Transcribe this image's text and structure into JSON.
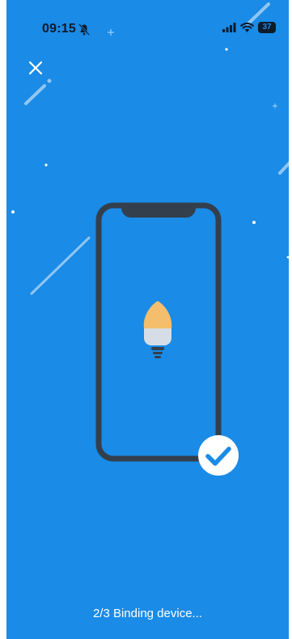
{
  "status_bar": {
    "time": "09:15",
    "battery_level": "37",
    "icons": [
      "bell-slash-icon",
      "cellular-signal-icon",
      "wifi-icon",
      "battery-icon"
    ]
  },
  "header": {
    "close_icon": "close-icon"
  },
  "illustration": {
    "device": "phone-outline",
    "bulb": "lightbulb-icon",
    "badge": "checkmark-icon"
  },
  "progress": {
    "message": "2/3 Binding device..."
  },
  "colors": {
    "background": "#1a8be6",
    "phone_frame": "#333f4c",
    "bulb_top": "#f4be6d",
    "bulb_base": "#d6dde6",
    "check": "#1a8be6"
  }
}
